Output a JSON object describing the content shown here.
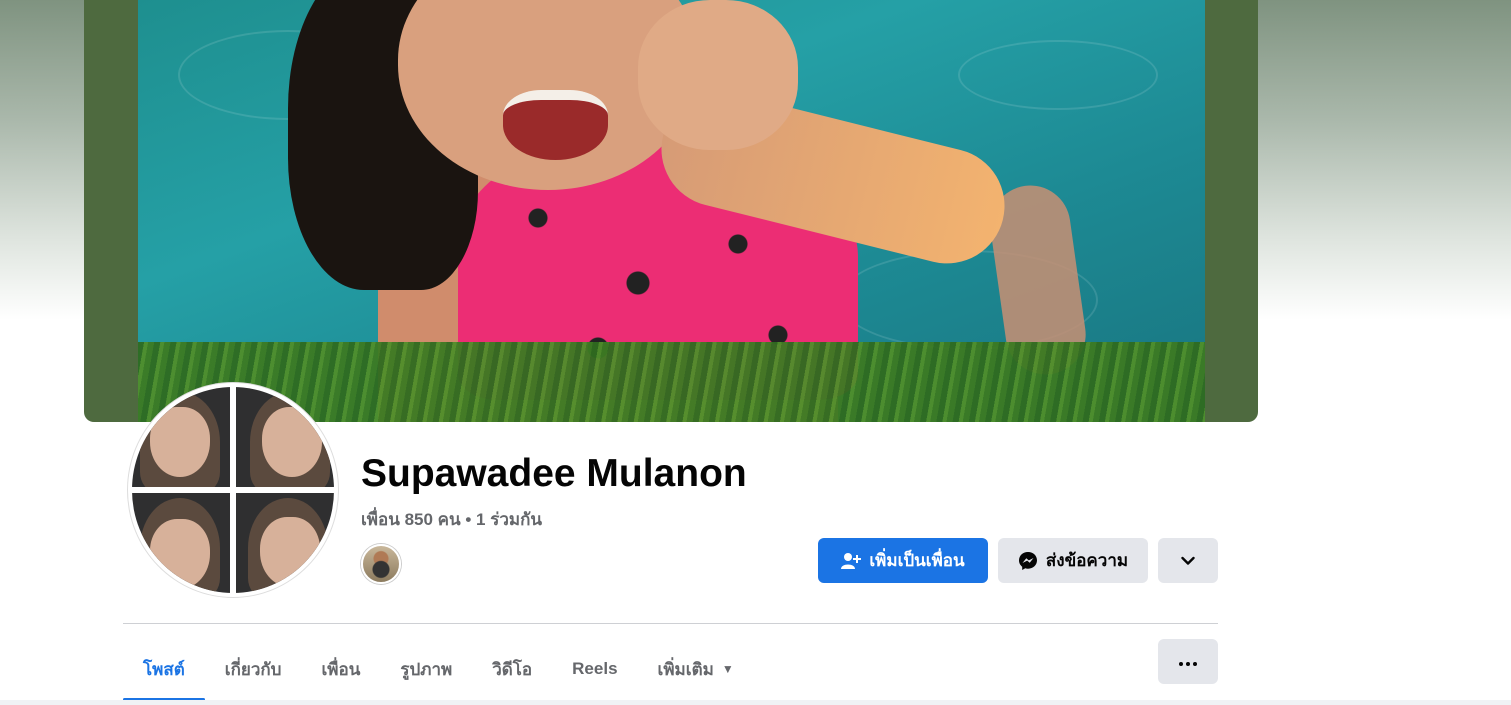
{
  "profile": {
    "name": "Supawadee Mulanon",
    "friends_summary": "เพื่อน 850 คน • 1 ร่วมกัน"
  },
  "actions": {
    "add_friend": {
      "label": "เพิ่มเป็นเพื่อน",
      "icon": "add-friend-icon"
    },
    "message": {
      "label": "ส่งข้อความ",
      "icon": "messenger-icon"
    },
    "more": {
      "icon": "chevron-down-icon"
    }
  },
  "tabs": [
    {
      "label": "โพสต์",
      "active": true
    },
    {
      "label": "เกี่ยวกับ",
      "active": false
    },
    {
      "label": "เพื่อน",
      "active": false
    },
    {
      "label": "รูปภาพ",
      "active": false
    },
    {
      "label": "วิดีโอ",
      "active": false
    },
    {
      "label": "Reels",
      "active": false
    },
    {
      "label": "เพิ่มเติม",
      "active": false,
      "dropdown": true
    }
  ],
  "tabs_overflow": {
    "icon": "ellipsis-icon"
  },
  "colors": {
    "accent": "#1b74e4",
    "secondary_button": "#e4e6eb",
    "muted_text": "#65676b",
    "swimsuit": "#ec2d74",
    "water": "#1d8a94"
  }
}
